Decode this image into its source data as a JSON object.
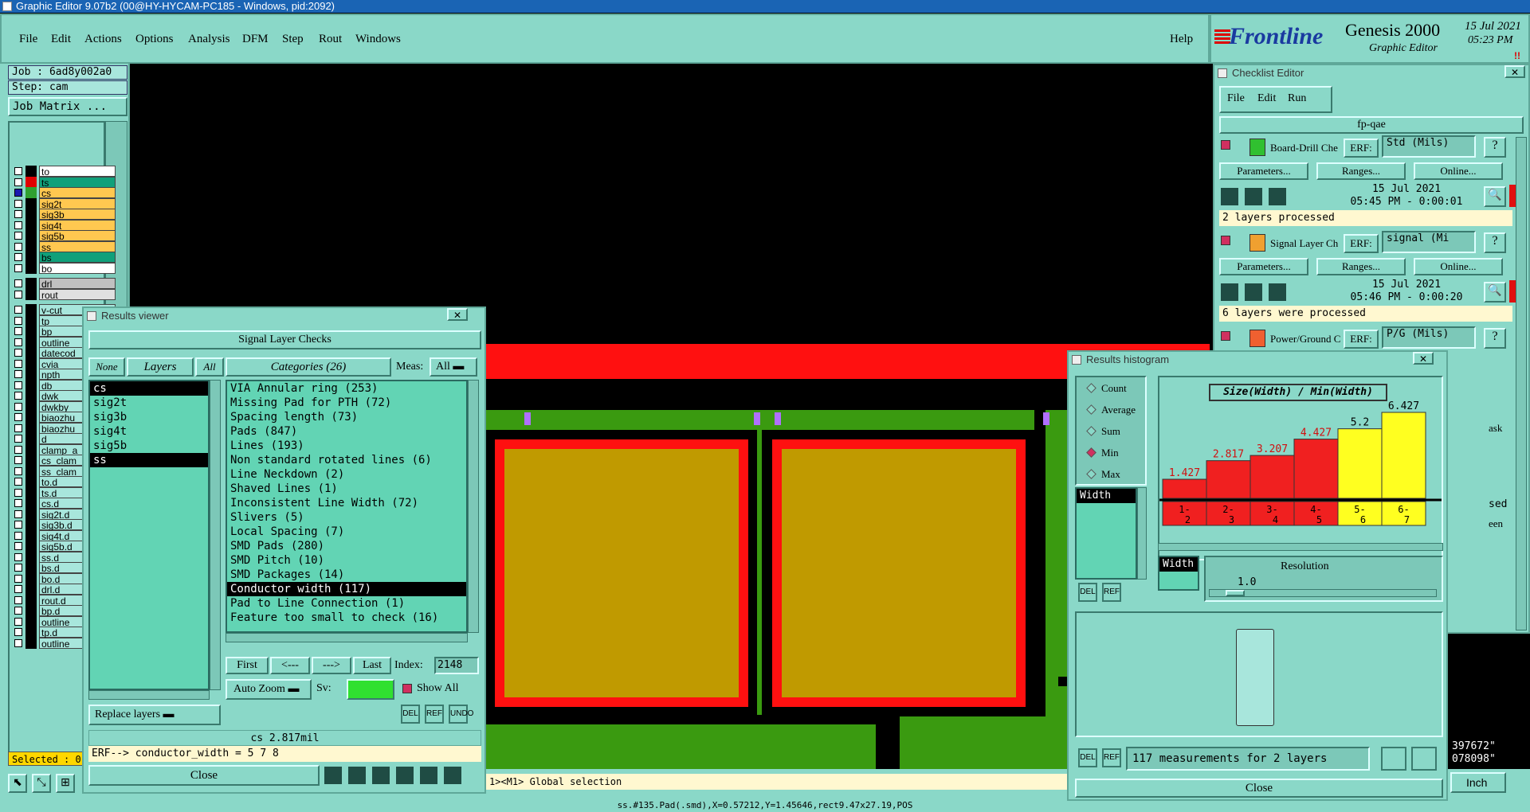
{
  "window_title": "Graphic Editor 9.07b2 (00@HY-HYCAM-PC185 - Windows, pid:2092)",
  "menu": [
    "File",
    "Edit",
    "Actions",
    "Options",
    "Analysis",
    "DFM",
    "Step",
    "Rout",
    "Windows"
  ],
  "help": "Help",
  "logo": {
    "brand": "Frontline",
    "product": "Genesis 2000",
    "sub": "Graphic Editor",
    "date": "15 Jul 2021",
    "time": "05:23 PM"
  },
  "job": "Job : 6ad8y002a0",
  "step": "Step: cam",
  "job_matrix": "Job Matrix ...",
  "layers": [
    {
      "name": "to",
      "color": "#ffffff"
    },
    {
      "name": "ts",
      "color": "#10a07a",
      "sw": "#e00000"
    },
    {
      "name": "cs",
      "color": "#ffc850",
      "sw": "#30a030",
      "active": true
    },
    {
      "name": "sig2t",
      "color": "#ffc850"
    },
    {
      "name": "sig3b",
      "color": "#ffc850"
    },
    {
      "name": "sig4t",
      "color": "#ffc850"
    },
    {
      "name": "sig5b",
      "color": "#ffc850"
    },
    {
      "name": "ss",
      "color": "#ffc850"
    },
    {
      "name": "bs",
      "color": "#10a07a"
    },
    {
      "name": "bo",
      "color": "#ffffff"
    },
    {
      "name": "drl",
      "color": "#c0c0c0",
      "gap": true
    },
    {
      "name": "rout",
      "color": "#e0e0e0"
    },
    {
      "name": "v-cut",
      "color": "#a8e6dc",
      "gap": true
    },
    {
      "name": "tp",
      "color": "#a8e6dc"
    },
    {
      "name": "bp",
      "color": "#a8e6dc"
    },
    {
      "name": "outline",
      "color": "#a8e6dc"
    },
    {
      "name": "datecod",
      "color": "#a8e6dc"
    },
    {
      "name": "cvia",
      "color": "#a8e6dc"
    },
    {
      "name": "npth",
      "color": "#a8e6dc"
    },
    {
      "name": "db",
      "color": "#a8e6dc"
    },
    {
      "name": "dwk",
      "color": "#a8e6dc"
    },
    {
      "name": "dwkby",
      "color": "#a8e6dc"
    },
    {
      "name": "biaozhu",
      "color": "#a8e6dc"
    },
    {
      "name": "biaozhu",
      "color": "#a8e6dc"
    },
    {
      "name": "d",
      "color": "#a8e6dc"
    },
    {
      "name": "clamp_a",
      "color": "#a8e6dc"
    },
    {
      "name": "cs_clam",
      "color": "#a8e6dc"
    },
    {
      "name": "ss_clam",
      "color": "#a8e6dc"
    },
    {
      "name": "to.d",
      "color": "#a8e6dc"
    },
    {
      "name": "ts.d",
      "color": "#a8e6dc"
    },
    {
      "name": "cs.d",
      "color": "#a8e6dc"
    },
    {
      "name": "sig2t.d",
      "color": "#a8e6dc"
    },
    {
      "name": "sig3b.d",
      "color": "#a8e6dc"
    },
    {
      "name": "sig4t.d",
      "color": "#a8e6dc"
    },
    {
      "name": "sig5b.d",
      "color": "#a8e6dc"
    },
    {
      "name": "ss.d",
      "color": "#a8e6dc"
    },
    {
      "name": "bs.d",
      "color": "#a8e6dc"
    },
    {
      "name": "bo.d",
      "color": "#a8e6dc"
    },
    {
      "name": "drl.d",
      "color": "#a8e6dc"
    },
    {
      "name": "rout.d",
      "color": "#a8e6dc"
    },
    {
      "name": "bp.d",
      "color": "#a8e6dc"
    },
    {
      "name": "outline",
      "color": "#a8e6dc"
    },
    {
      "name": "tp.d",
      "color": "#a8e6dc"
    },
    {
      "name": "outline",
      "color": "#a8e6dc"
    }
  ],
  "selected": "Selected : 0",
  "status_bottom": "ss.#135.Pad(.smd),X=0.57212,Y=1.45646,rect9.47x27.19,POS",
  "mouse_hint": "1><M1> Global selection",
  "coords": {
    "x": "397672\"",
    "y": "078098\""
  },
  "units": "Inch",
  "results_viewer": {
    "title": "Results viewer",
    "header": "Signal Layer Checks",
    "none": "None",
    "layers": "Layers",
    "all": "All",
    "layer_list": [
      {
        "name": "cs",
        "sel": true
      },
      {
        "name": "sig2t"
      },
      {
        "name": "sig3b"
      },
      {
        "name": "sig4t"
      },
      {
        "name": "sig5b"
      },
      {
        "name": "ss",
        "sel": true
      }
    ],
    "categories_label": "Categories (26)",
    "meas_label": "Meas:",
    "meas_value": "All",
    "categories": [
      {
        "t": "VIA Annular ring (253)"
      },
      {
        "t": "Missing Pad for PTH (72)"
      },
      {
        "t": "Spacing length (73)"
      },
      {
        "t": "Pads (847)"
      },
      {
        "t": "Lines (193)"
      },
      {
        "t": "Non standard rotated lines (6)"
      },
      {
        "t": "Line Neckdown (2)"
      },
      {
        "t": "Shaved Lines (1)"
      },
      {
        "t": "Inconsistent Line Width (72)"
      },
      {
        "t": "Slivers (5)"
      },
      {
        "t": "Local Spacing (7)"
      },
      {
        "t": "SMD Pads (280)"
      },
      {
        "t": "SMD Pitch (10)"
      },
      {
        "t": "SMD Packages (14)"
      },
      {
        "t": "Conductor width (117)",
        "sel": true
      },
      {
        "t": "Pad to Line Connection (1)"
      },
      {
        "t": "Feature too small to check (16)"
      }
    ],
    "first": "First",
    "prev": "<---",
    "next": "--->",
    "last": "Last",
    "index_label": "Index:",
    "index_value": "2148",
    "auto_zoom": "Auto Zoom",
    "sv_label": "Sv:",
    "show_all": "Show All",
    "replace_layers": "Replace layers",
    "status1": "cs 2.817mil",
    "status2": "ERF--> conductor_width = 5 7 8",
    "close": "Close",
    "del": "DEL",
    "ref": "REF",
    "undo": "UNDO"
  },
  "checklist": {
    "title": "Checklist Editor",
    "menu": [
      "File",
      "Edit",
      "Run"
    ],
    "name": "fp-qae",
    "erf_label": "ERF:",
    "items": [
      {
        "name": "Board-Drill Che",
        "erf": "Std (Mils)",
        "date": "15 Jul 2021",
        "time": "05:45 PM - 0:00:01",
        "msg": "2 layers processed"
      },
      {
        "name": "Signal Layer Ch",
        "erf": "signal (Mi",
        "date": "15 Jul 2021",
        "time": "05:46 PM - 0:00:20",
        "msg": "6 layers were processed"
      },
      {
        "name": "Power/Ground C",
        "erf": "P/G (Mils)"
      }
    ],
    "params": "Parameters...",
    "ranges": "Ranges...",
    "online": "Online...",
    "partial": [
      "ask",
      "sed",
      "een"
    ]
  },
  "histogram": {
    "title": "Results histogram",
    "modes": [
      "Count",
      "Average",
      "Sum",
      "Min",
      "Max"
    ],
    "selected_mode": "Min",
    "field": "Width",
    "chart_title": "Size(Width) / Min(Width)",
    "resolution_label": "Resolution",
    "resolution_value": "1.0",
    "summary": "117 measurements for 2 layers",
    "close": "Close",
    "chart_data": {
      "type": "bar",
      "categories": [
        "1-2",
        "2-3",
        "3-4",
        "4-5",
        "5-6",
        "6-7"
      ],
      "values": [
        1.427,
        2.817,
        3.207,
        4.427,
        5.2,
        6.427
      ],
      "labels": [
        "1.427",
        "2.817",
        "3.207",
        "4.427",
        "5.2",
        "6.427"
      ],
      "colors": [
        "#f02020",
        "#f02020",
        "#f02020",
        "#f02020",
        "#ffff20",
        "#ffff20"
      ],
      "ylim": [
        0,
        6.427
      ]
    }
  }
}
